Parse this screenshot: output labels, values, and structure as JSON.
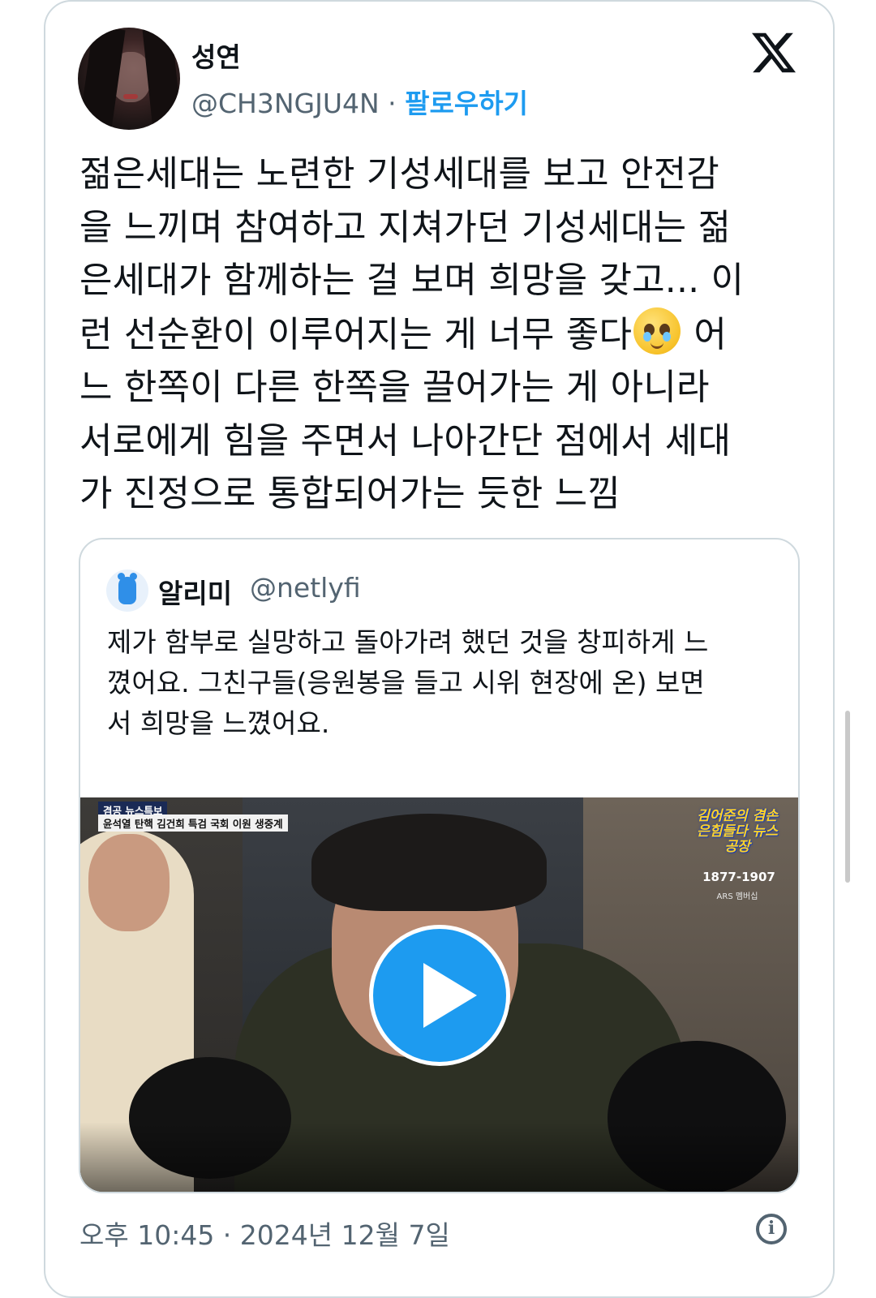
{
  "tweet": {
    "author_name": "성연",
    "author_handle": "@CH3NGJU4N",
    "separator": " · ",
    "follow_label": "팔로우하기",
    "logo_icon": "x-logo-icon",
    "text_before_emoji": "젊은세대는 노련한 기성세대를 보고 안전감\n을 느끼며 참여하고 지쳐가던 기성세대는 젊\n은세대가 함께하는 걸 보며 희망을 갖고... 이\n런 선순환이 이루어지는 게 너무 좋다",
    "text_after_emoji": " 어\n느 한쪽이 다른 한쪽을 끌어가는 게 아니라\n서로에게 힘을 주면서 나아간단 점에서 세대\n가 진정으로 통합되어가는 듯한 느낌",
    "emoji": "face-holding-back-tears-emoji",
    "timestamp": "오후 10:45 · 2024년 12월 7일"
  },
  "quoted": {
    "name": "알리미",
    "handle": "@netlyfi",
    "text": "제가 함부로 실망하고 돌아가려 했던 것을 창피하게 느\n꼈어요. 그친구들(응원봉을 들고 시위 현장에 온) 보면\n서 희망을 느꼈어요.",
    "video": {
      "caption_top": "겸공 뉴스특보",
      "caption_bottom": "윤석열 탄핵 김건희 특검 국회 이원 생중계",
      "show_title": "김어준의 겸손은힘들다 뉴스공장",
      "phone": "1877-1907",
      "ars_label": "ARS 멤버십"
    }
  },
  "colors": {
    "accent": "#1d9bf0",
    "secondary_text": "#536471",
    "border": "#cfd9de"
  }
}
